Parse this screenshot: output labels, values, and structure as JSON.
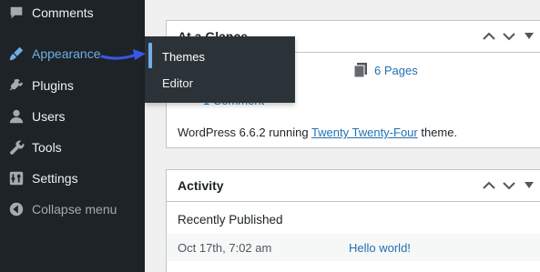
{
  "sidebar": {
    "items": [
      {
        "label": "Comments",
        "icon": "comment-icon"
      },
      {
        "label": "Appearance",
        "icon": "paintbrush-icon",
        "active": true
      },
      {
        "label": "Plugins",
        "icon": "plugin-icon"
      },
      {
        "label": "Users",
        "icon": "user-icon"
      },
      {
        "label": "Tools",
        "icon": "wrench-icon"
      },
      {
        "label": "Settings",
        "icon": "settings-icon"
      },
      {
        "label": "Collapse menu",
        "icon": "collapse-icon"
      }
    ]
  },
  "flyout": {
    "items": [
      {
        "label": "Themes",
        "current": true
      },
      {
        "label": "Editor"
      }
    ]
  },
  "glance": {
    "title": "At a Glance",
    "pages_link": "6 Pages",
    "comment_link": "1 Comment",
    "version_prefix": "WordPress 6.6.2 running ",
    "theme_link": "Twenty Twenty-Four",
    "version_suffix": " theme."
  },
  "activity": {
    "title": "Activity",
    "recent_title": "Recently Published",
    "row_date": "Oct 17th, 7:02 am",
    "row_link": "Hello world!"
  },
  "colors": {
    "sidebar_bg": "#1d2327",
    "flyout_bg": "#2c3338",
    "accent": "#72aee6",
    "link": "#2271b1",
    "arrow": "#3858e9"
  }
}
